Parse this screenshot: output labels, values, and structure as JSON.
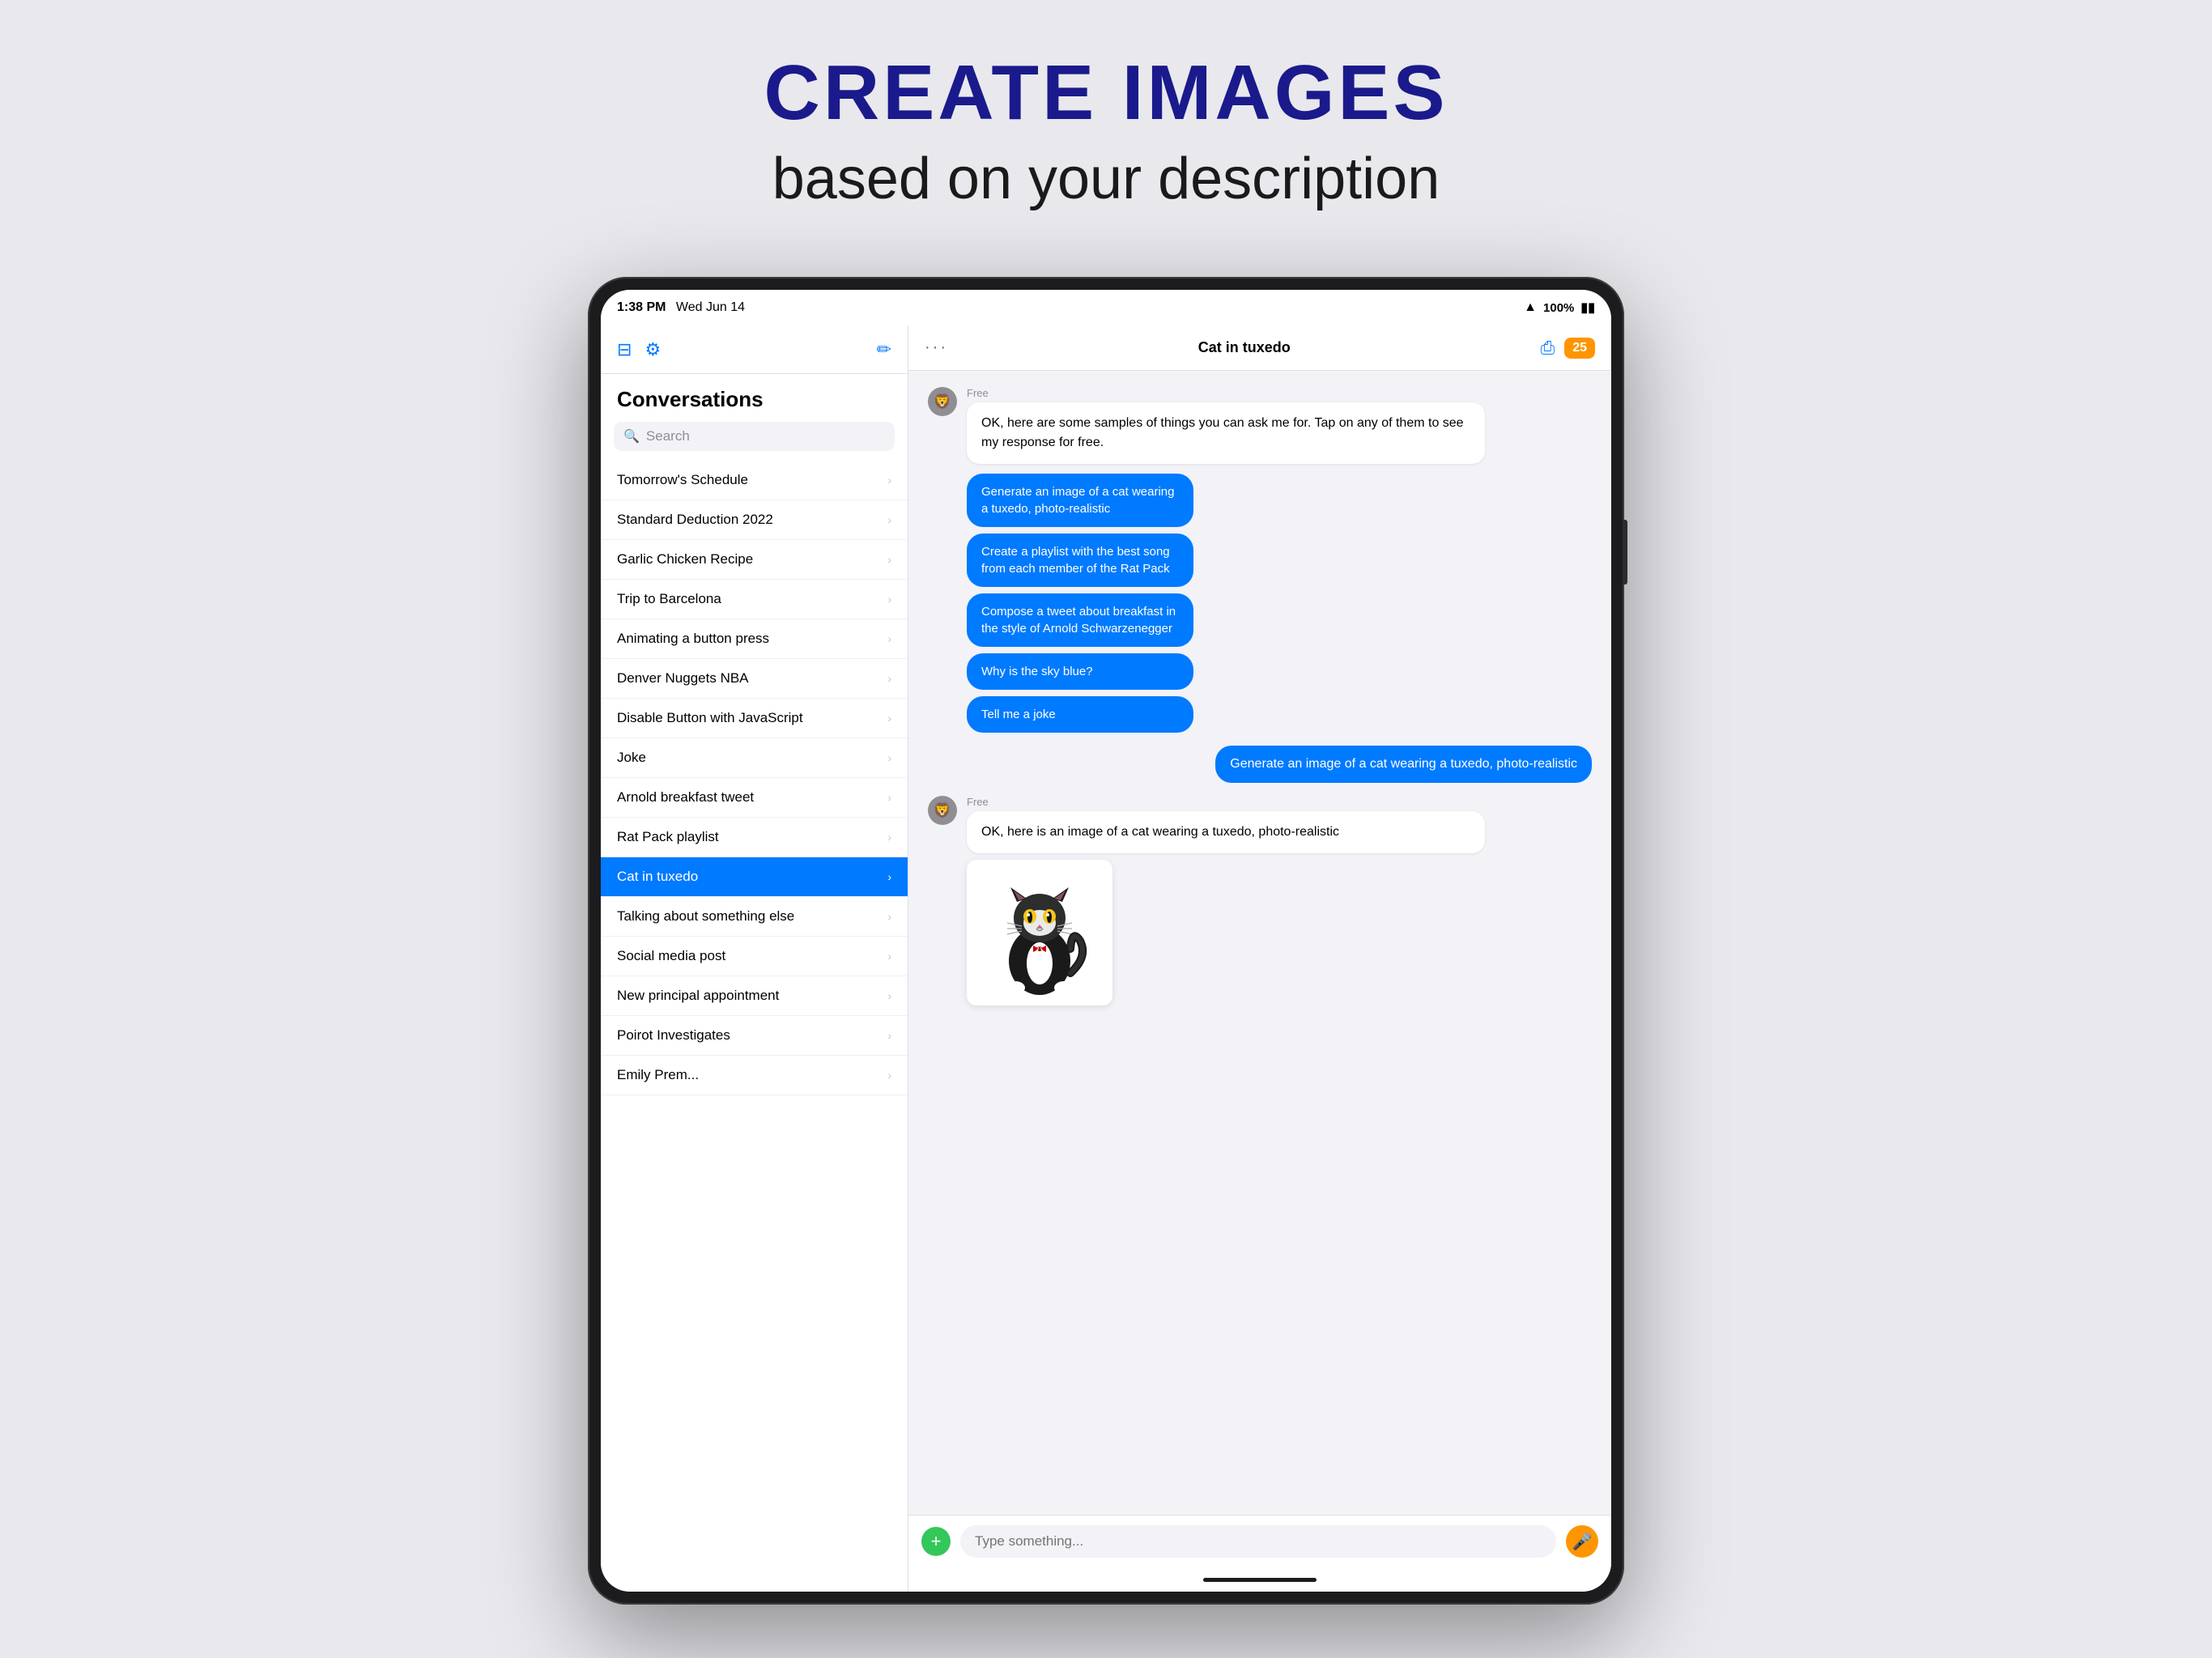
{
  "header": {
    "title": "CREATE IMAGES",
    "subtitle": "based on your description"
  },
  "statusBar": {
    "time": "1:38 PM",
    "date": "Wed Jun 14",
    "battery": "100%",
    "batteryIcon": "🔋"
  },
  "sidebar": {
    "title": "Conversations",
    "searchPlaceholder": "Search",
    "newChatIcon": "✏",
    "sidebarIcon": "⊟",
    "gearIcon": "⚙",
    "conversations": [
      {
        "id": 1,
        "label": "Tomorrow's Schedule",
        "active": false
      },
      {
        "id": 2,
        "label": "Standard Deduction 2022",
        "active": false
      },
      {
        "id": 3,
        "label": "Garlic Chicken Recipe",
        "active": false
      },
      {
        "id": 4,
        "label": "Trip to Barcelona",
        "active": false
      },
      {
        "id": 5,
        "label": "Animating a button press",
        "active": false
      },
      {
        "id": 6,
        "label": "Denver Nuggets NBA",
        "active": false
      },
      {
        "id": 7,
        "label": "Disable Button with JavaScript",
        "active": false
      },
      {
        "id": 8,
        "label": "Joke",
        "active": false
      },
      {
        "id": 9,
        "label": "Arnold breakfast tweet",
        "active": false
      },
      {
        "id": 10,
        "label": "Rat Pack playlist",
        "active": false
      },
      {
        "id": 11,
        "label": "Cat in tuxedo",
        "active": true
      },
      {
        "id": 12,
        "label": "Talking about something else",
        "active": false
      },
      {
        "id": 13,
        "label": "Social media post",
        "active": false
      },
      {
        "id": 14,
        "label": "New principal appointment",
        "active": false
      },
      {
        "id": 15,
        "label": "Poirot Investigates",
        "active": false
      },
      {
        "id": 16,
        "label": "Emily Prem...",
        "active": false
      }
    ]
  },
  "chat": {
    "title": "Cat in tuxedo",
    "badgeCount": "25",
    "freeLabel": "Free",
    "botWelcome": "OK, here are some samples of things you can ask me for. Tap on any of them to see my response for free.",
    "suggestions": [
      "Generate an image of a cat wearing a tuxedo, photo-realistic",
      "Create a playlist with the best song from each member of the Rat Pack",
      "Compose a tweet about breakfast in the style of Arnold Schwarzenegger",
      "Why is the sky blue?",
      "Tell me a joke"
    ],
    "userMessage": "Generate an image of a cat wearing a tuxedo, photo-realistic",
    "botResponse": "OK, here is an image of a cat wearing a tuxedo, photo-realistic",
    "inputPlaceholder": "Type something..."
  }
}
